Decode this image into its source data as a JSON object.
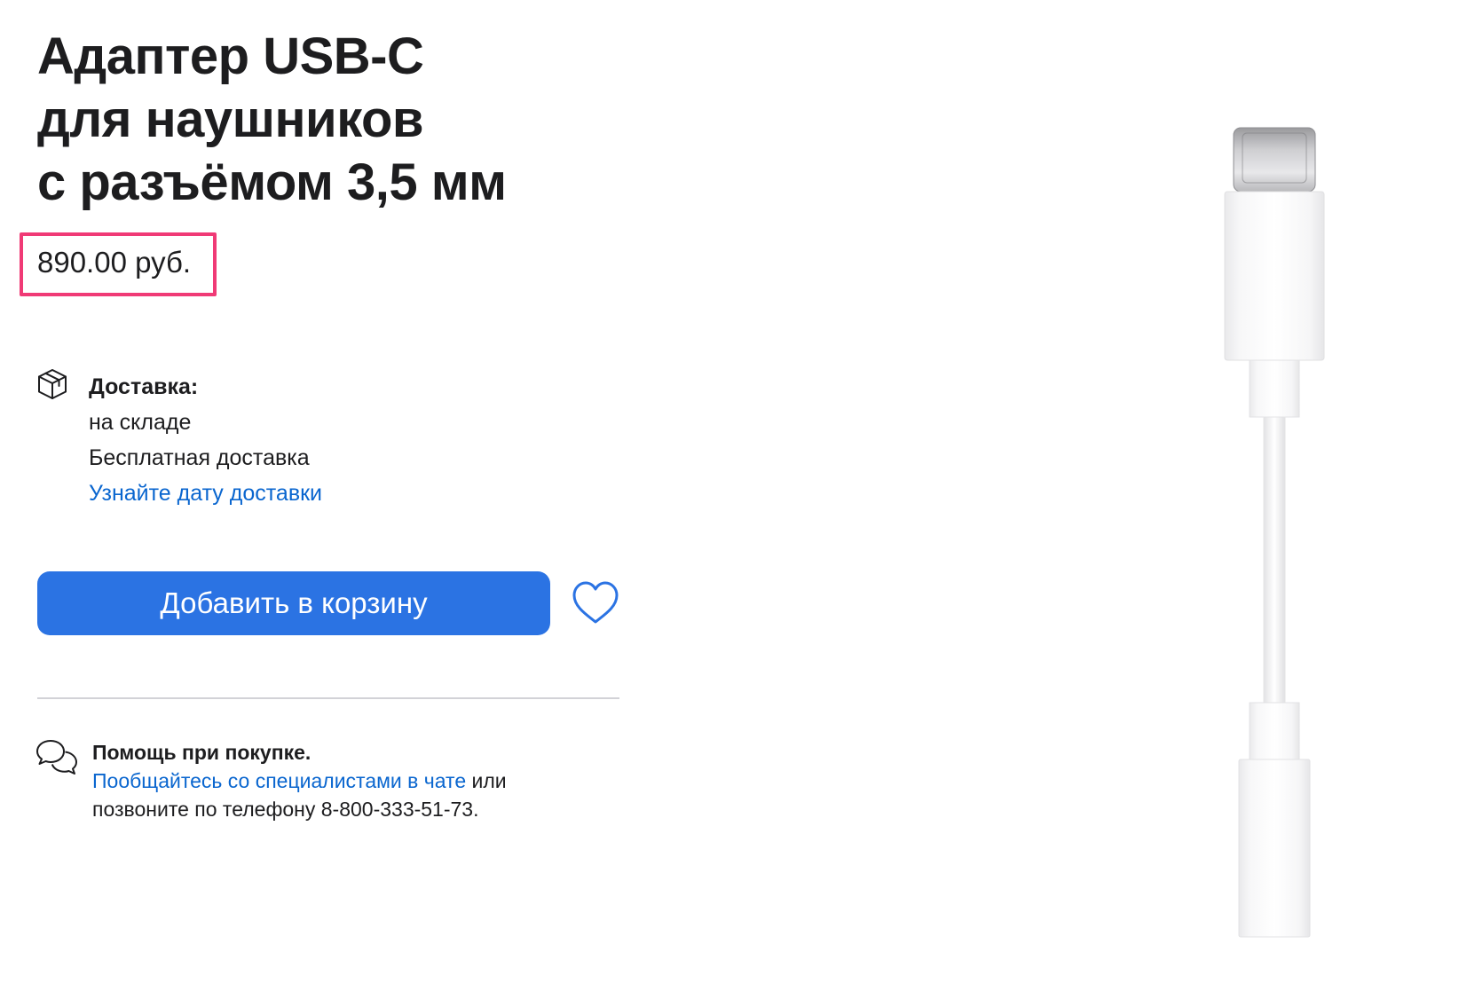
{
  "product": {
    "title_lines": [
      "Адаптер USB-C",
      "для наушников",
      "с разъёмом 3,5 мм"
    ],
    "price": "890.00 руб."
  },
  "delivery": {
    "icon": "box-icon",
    "title": "Доставка:",
    "stock": "на складе",
    "shipping": "Бесплатная доставка",
    "date_link": "Узнайте дату доставки"
  },
  "actions": {
    "add_to_cart": "Добавить в корзину",
    "favorite_icon": "heart-icon"
  },
  "help": {
    "icon": "chat-bubbles-icon",
    "title": "Помощь при покупке.",
    "chat_link": "Пообщайтесь со специалистами в чате",
    "or_text": " или",
    "phone_text": "позвоните по телефону 8-800-333-51-73."
  },
  "colors": {
    "highlight_border": "#f03a76",
    "button": "#2b73e3",
    "link": "#0a66cf",
    "text": "#1d1d1f"
  }
}
